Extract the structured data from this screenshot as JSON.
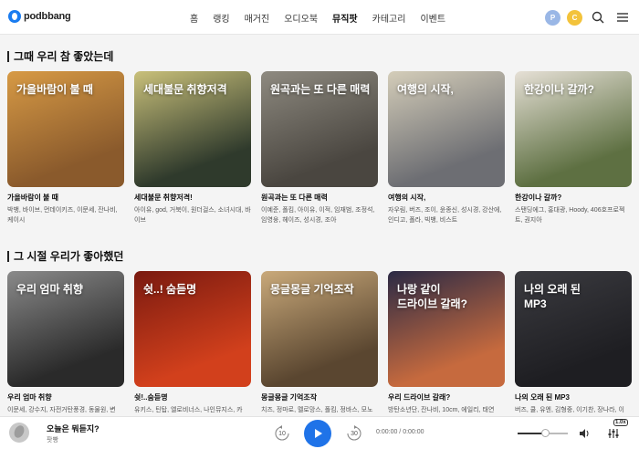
{
  "header": {
    "logo_text": "podbbang",
    "nav": [
      {
        "label": "홈",
        "active": false
      },
      {
        "label": "랭킹",
        "active": false
      },
      {
        "label": "매거진",
        "active": false
      },
      {
        "label": "오디오북",
        "active": false
      },
      {
        "label": "뮤직팟",
        "active": true
      },
      {
        "label": "카테고리",
        "active": false
      },
      {
        "label": "이벤트",
        "active": false
      }
    ],
    "point_badge": "P",
    "coin_badge": "C",
    "icons": [
      "search-icon",
      "menu-icon"
    ]
  },
  "sections": [
    {
      "title": "그때 우리 참 좋았는데",
      "cards": [
        {
          "overlay": "가을바람이 불 때",
          "title": "가을바람이 불 때",
          "desc": "박뱅, 바이브, 먼데이키즈, 이문세, 잔나비, 케이시",
          "bg": "#8a5a2c",
          "bg2": "#d79a45"
        },
        {
          "overlay": "세대불문 취향저격",
          "title": "세대불문 취향저격!",
          "desc": "아이유, god, 거북이, 원더걸스, 소녀시대, 바이브",
          "bg": "#2f3a2c",
          "bg2": "#c9c07a"
        },
        {
          "overlay": "원곡과는 또 다른 매력",
          "title": "원곡과는 또 다른 매력",
          "desc": "이예준, 폴킴, 아이유, 이적, 임재범, 조정석, 임영웅, 헤이즈, 성시경, 조아",
          "bg": "#4a4640",
          "bg2": "#8e8a80"
        },
        {
          "overlay": "여행의 시작,",
          "title": "여행의 시작,",
          "desc": "자우림, 버즈, 조이, 윤종신, 성시경, 강산에, 인디고, 폴라, 빅뱅, 비스트",
          "bg": "#6d6e73",
          "bg2": "#d4cdb9"
        },
        {
          "overlay": "한강이나 갈까?",
          "title": "한강이나 갈까?",
          "desc": "스탠딩에그, 홍대광, Hoody, 406호프로젝트, 권지아",
          "bg": "#5e7042",
          "bg2": "#e6e0d6"
        }
      ]
    },
    {
      "title": "그 시절 우리가 좋아했던",
      "cards": [
        {
          "overlay": "우리 엄마 취향",
          "title": "우리 엄마 취향",
          "desc": "이문세, 강수지, 자전거탄풍경, 동물원, 변",
          "bg": "#2a2a2a",
          "bg2": "#8a8a8a"
        },
        {
          "overlay": "쉿..! 숨듣명",
          "title": "쉿!..숨듣명",
          "desc": "유키스, 틴탑, 엘로비너스, 나인뮤지스, 카",
          "bg": "#d2401c",
          "bg2": "#7a1a10"
        },
        {
          "overlay": "몽글몽글 기억조작",
          "title": "몽글몽글 기억조작",
          "desc": "치즈, 정마로, 멜로망스, 폴킴, 정바스, 모노",
          "bg": "#5a4630",
          "bg2": "#c9a97a"
        },
        {
          "overlay": "나랑 같이\n드라이브 갈래?",
          "title": "우리 드라이브 갈래?",
          "desc": "방탄소년단, 잔나비, 10cm, 에일리, 태연",
          "bg": "#c66a3e",
          "bg2": "#2b2a45"
        },
        {
          "overlay": "나의 오래 된\nMP3",
          "title": "나의 오래 된 MP3",
          "desc": "버즈, 쿨, 유엔, 김형중, 이기찬, 장나라, 이",
          "bg": "#1e1e22",
          "bg2": "#3b3b40"
        }
      ]
    }
  ],
  "player": {
    "title": "오늘은 뭐듣지?",
    "subtitle": "팟빵",
    "rewind": "10",
    "forward": "30",
    "time": "0:00:00 / 0:00:00",
    "speed": "1.0x",
    "volume_level": 0.55
  },
  "colors": {
    "accent": "#1f73e8"
  }
}
